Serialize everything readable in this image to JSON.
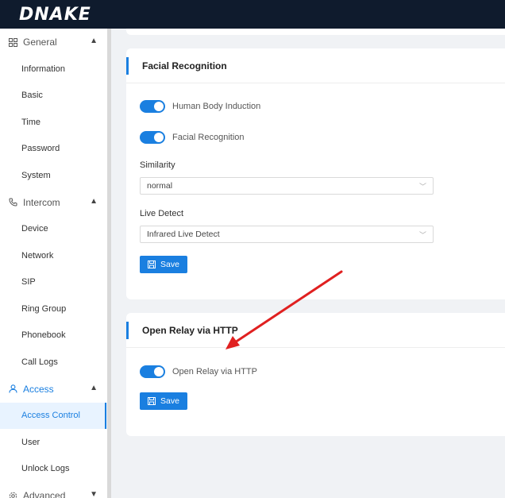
{
  "brand": {
    "logo_text": "DNAKE"
  },
  "sidebar": {
    "groups": [
      {
        "label": "General",
        "icon": "grid-icon",
        "chevron": "▲",
        "items": [
          "Information",
          "Basic",
          "Time",
          "Password",
          "System"
        ]
      },
      {
        "label": "Intercom",
        "icon": "phone-icon",
        "chevron": "▲",
        "items": [
          "Device",
          "Network",
          "SIP",
          "Ring Group",
          "Phonebook",
          "Call Logs"
        ]
      },
      {
        "label": "Access",
        "icon": "user-icon",
        "chevron": "▲",
        "items": [
          "Access Control",
          "User",
          "Unlock Logs"
        ]
      },
      {
        "label": "Advanced",
        "icon": "gear-icon",
        "chevron": "▼",
        "items": []
      }
    ],
    "selected_item": "Access Control"
  },
  "facial": {
    "title": "Facial Recognition",
    "toggle1_label": "Human Body Induction",
    "toggle2_label": "Facial Recognition",
    "similarity_label": "Similarity",
    "similarity_value": "normal",
    "live_detect_label": "Live Detect",
    "live_detect_value": "Infrared Live Detect",
    "save_label": "Save"
  },
  "relay": {
    "title": "Open Relay via HTTP",
    "toggle_label": "Open Relay via HTTP",
    "save_label": "Save"
  },
  "colors": {
    "accent": "#1a7fe0",
    "topbar": "#0f1b2d",
    "annotation_arrow": "#e02020"
  }
}
